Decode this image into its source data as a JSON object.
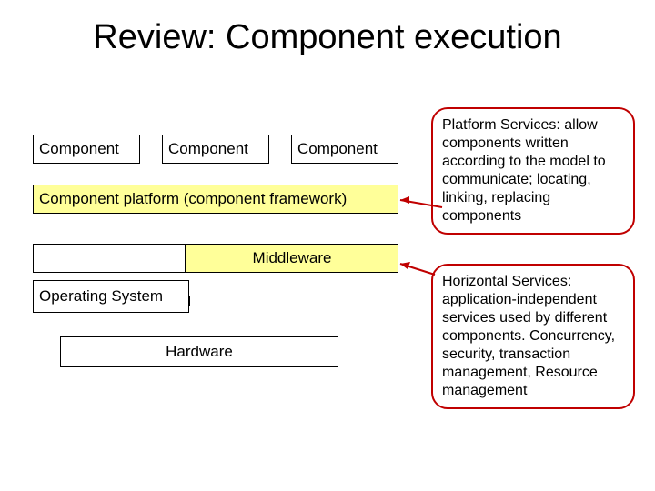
{
  "title": "Review: Component execution",
  "boxes": {
    "component1": "Component",
    "component2": "Component",
    "component3": "Component",
    "platform": "Component platform (component framework)",
    "middleware": "Middleware",
    "os": "Operating System",
    "hardware": "Hardware"
  },
  "callouts": {
    "platform_services": "Platform Services: allow components written according to the model to communicate; locating, linking, replacing components",
    "horizontal_services": "Horizontal Services: application-independent services used by different components.  Concurrency, security, transaction management, Resource management"
  }
}
